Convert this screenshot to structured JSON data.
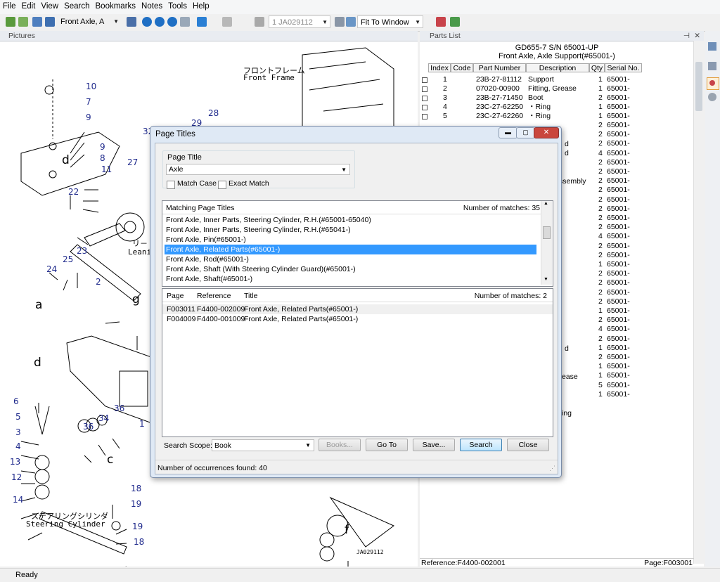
{
  "menu": [
    "File",
    "Edit",
    "View",
    "Search",
    "Bookmarks",
    "Notes",
    "Tools",
    "Help"
  ],
  "toolbar": {
    "book_combo": "Front Axle, A",
    "page_combo": "1 JA029112",
    "zoom_combo": "Fit To Window"
  },
  "pictures_panel": {
    "title": "Pictures"
  },
  "drawing": {
    "labels": [
      {
        "t": "10"
      },
      {
        "t": "7"
      },
      {
        "t": "9"
      },
      {
        "t": "9"
      },
      {
        "t": "8"
      },
      {
        "t": "11"
      },
      {
        "t": "22"
      },
      {
        "t": "27"
      },
      {
        "t": "28"
      },
      {
        "t": "29"
      },
      {
        "t": "32"
      },
      {
        "t": "23"
      },
      {
        "t": "24"
      },
      {
        "t": "25"
      },
      {
        "t": "2"
      },
      {
        "t": "6"
      },
      {
        "t": "5"
      },
      {
        "t": "3"
      },
      {
        "t": "4"
      },
      {
        "t": "13"
      },
      {
        "t": "12"
      },
      {
        "t": "14"
      },
      {
        "t": "36"
      },
      {
        "t": "34"
      },
      {
        "t": "36"
      },
      {
        "t": "1"
      },
      {
        "t": "18"
      },
      {
        "t": "19"
      },
      {
        "t": "19"
      },
      {
        "t": "18"
      }
    ],
    "letters": [
      "d",
      "a",
      "g",
      "d",
      "c",
      "f"
    ],
    "front_frame_jp": "フロントフレーム",
    "front_frame_en": "Front Frame",
    "leaning_jp": "リ－",
    "leaning_en": "Leani",
    "steering_jp": "ステアリングシリンダ",
    "steering_en": "Steering Cylinder",
    "drawing_id": "JA029112"
  },
  "parts_panel": {
    "title": "Parts List",
    "model": "GD655-7 S/N 65001-UP",
    "subtitle": "Front Axle, Axle Support(#65001-)",
    "columns": [
      "Index",
      "Code",
      "Part Number",
      "Description",
      "Qty",
      "Serial No."
    ],
    "rows": [
      {
        "index": "1",
        "code": "",
        "part": "23B-27-81112",
        "desc": "Support",
        "qty": "1",
        "serial": "65001-"
      },
      {
        "index": "2",
        "code": "",
        "part": "07020-00900",
        "desc": "Fitting, Grease",
        "qty": "1",
        "serial": "65001-"
      },
      {
        "index": "3",
        "code": "",
        "part": "23B-27-71450",
        "desc": "Boot",
        "qty": "2",
        "serial": "65001-"
      },
      {
        "index": "4",
        "code": "",
        "part": "23C-27-62250",
        "desc": "・Ring",
        "qty": "1",
        "serial": "65001-"
      },
      {
        "index": "5",
        "code": "",
        "part": "23C-27-62260",
        "desc": "・Ring",
        "qty": "1",
        "serial": "65001-"
      }
    ],
    "partial_desc": [
      "d",
      "d",
      "ssembly",
      "d",
      "ease",
      "ing"
    ],
    "qty_more": [
      "2",
      "2",
      "2",
      "4",
      "2",
      "2",
      "2",
      "2",
      "2",
      "2",
      "2",
      "2",
      "4",
      "2",
      "2",
      "1",
      "2",
      "2",
      "2",
      "2",
      "1",
      "2",
      "4",
      "2",
      "1",
      "2",
      "1",
      "1",
      "5",
      "1"
    ],
    "serial_more": "65001-",
    "reference": "Reference:F4400-002001",
    "page": "Page:F003001"
  },
  "dialog": {
    "title": "Page Titles",
    "page_title_group": "Page Title",
    "query": "Axle",
    "match_case": "Match Case",
    "exact_match": "Exact Match",
    "matching_header": "Matching Page Titles",
    "matching_count": "Number of matches: 35",
    "matches": [
      "Front Axle, Inner Parts, Steering Cylinder, R.H.(#65001-65040)",
      "Front Axle, Inner Parts, Steering Cylinder, R.H.(#65041-)",
      "Front Axle, Pin(#65001-)",
      "Front Axle, Related Parts(#65001-)",
      "Front Axle, Rod(#65001-)",
      "Front Axle, Shaft (With Steering Cylinder Guard)(#65001-)",
      "Front Axle, Shaft(#65001-)"
    ],
    "results_columns": [
      "Page",
      "Reference",
      "Title"
    ],
    "results_count": "Number of matches: 2",
    "results": [
      {
        "page": "F003011",
        "ref": "F4400-002009",
        "title": "Front Axle, Related Parts(#65001-)"
      },
      {
        "page": "F004009",
        "ref": "F4400-001009",
        "title": "Front Axle, Related Parts(#65001-)"
      }
    ],
    "scope_label": "Search Scope:",
    "scope_value": "Book",
    "books_btn": "Books...",
    "goto_btn": "Go To",
    "save_btn": "Save...",
    "search_btn": "Search",
    "close_btn": "Close",
    "status": "Number of occurrences found: 40"
  },
  "status": "Ready",
  "colors": {
    "selection": "#3399ff",
    "label_blue": "#1f2a8c"
  }
}
